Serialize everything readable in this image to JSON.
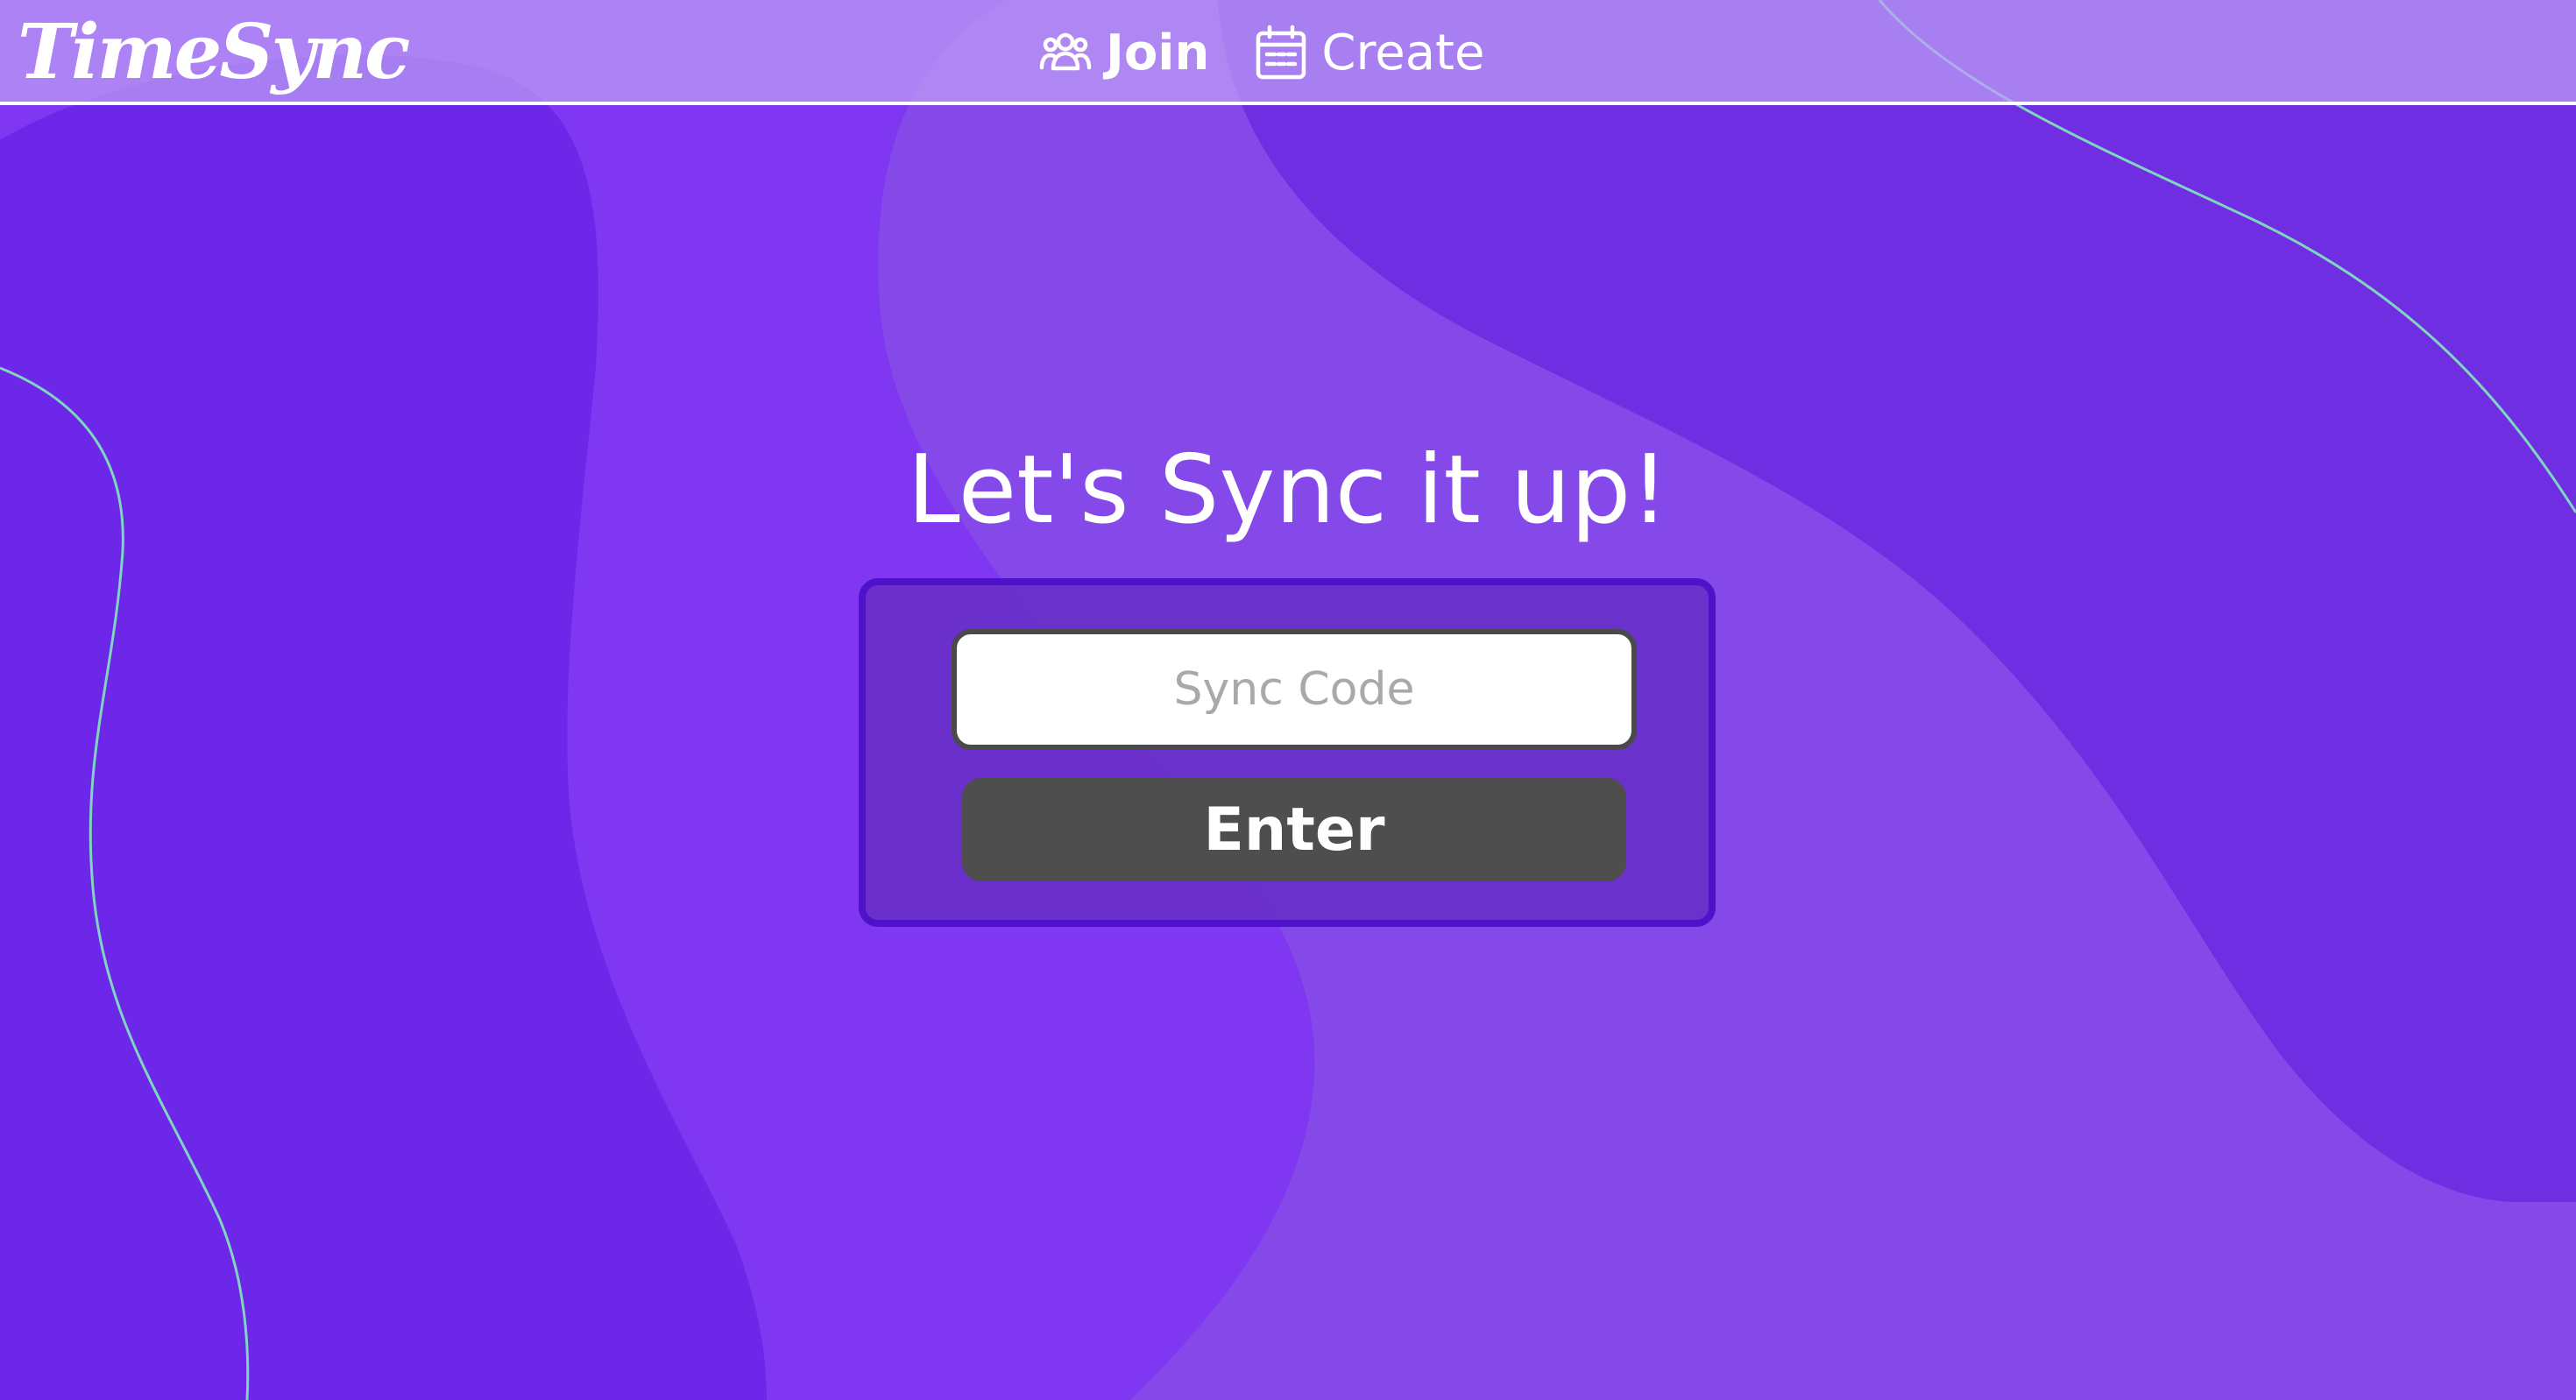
{
  "app": {
    "logo": "TimeSync"
  },
  "nav": {
    "join_label": "Join",
    "join_icon": "users-icon",
    "create_label": "Create",
    "create_icon": "calendar-icon"
  },
  "main": {
    "heading": "Let's Sync it up!",
    "code_placeholder": "Sync Code",
    "code_value": "",
    "enter_label": "Enter"
  },
  "colors": {
    "background": "#7f37f2",
    "navbar": "#bea0f5",
    "card_border": "#4d12c9",
    "button": "#4e4e4e",
    "accent_line": "#7fd6c0"
  }
}
